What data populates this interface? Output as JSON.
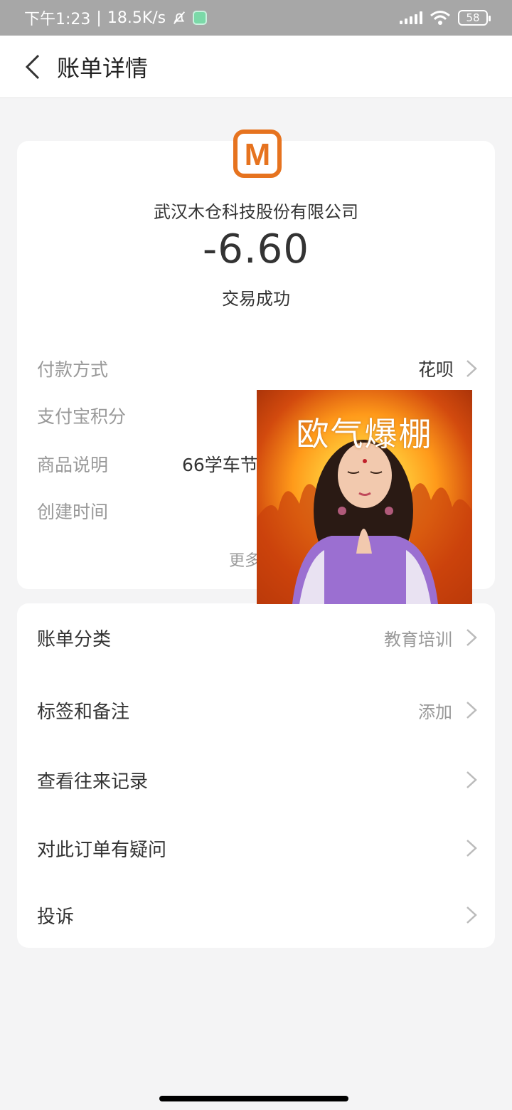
{
  "status_bar": {
    "time": "下午1:23",
    "net_speed": "18.5K/s",
    "battery": "58"
  },
  "header": {
    "title": "账单详情"
  },
  "bill": {
    "merchant_logo_letter": "M",
    "merchant_name": "武汉木仓科技股份有限公司",
    "amount": "-6.60",
    "status": "交易成功",
    "details": {
      "payment_method_label": "付款方式",
      "payment_method_value": "花呗",
      "points_label": "支付宝积分",
      "goods_label": "商品说明",
      "goods_value": "66学车节",
      "created_label": "创建时间"
    },
    "more": "更多"
  },
  "actions": {
    "category_label": "账单分类",
    "category_value": "教育培训",
    "tags_label": "标签和备注",
    "tags_value": "添加",
    "history_label": "查看往来记录",
    "question_label": "对此订单有疑问",
    "complaint_label": "投诉"
  },
  "sticker": {
    "text": "欧气爆棚"
  },
  "colors": {
    "brand_logo": "#e6731f",
    "label_gray": "#999999",
    "text_dark": "#333333"
  }
}
